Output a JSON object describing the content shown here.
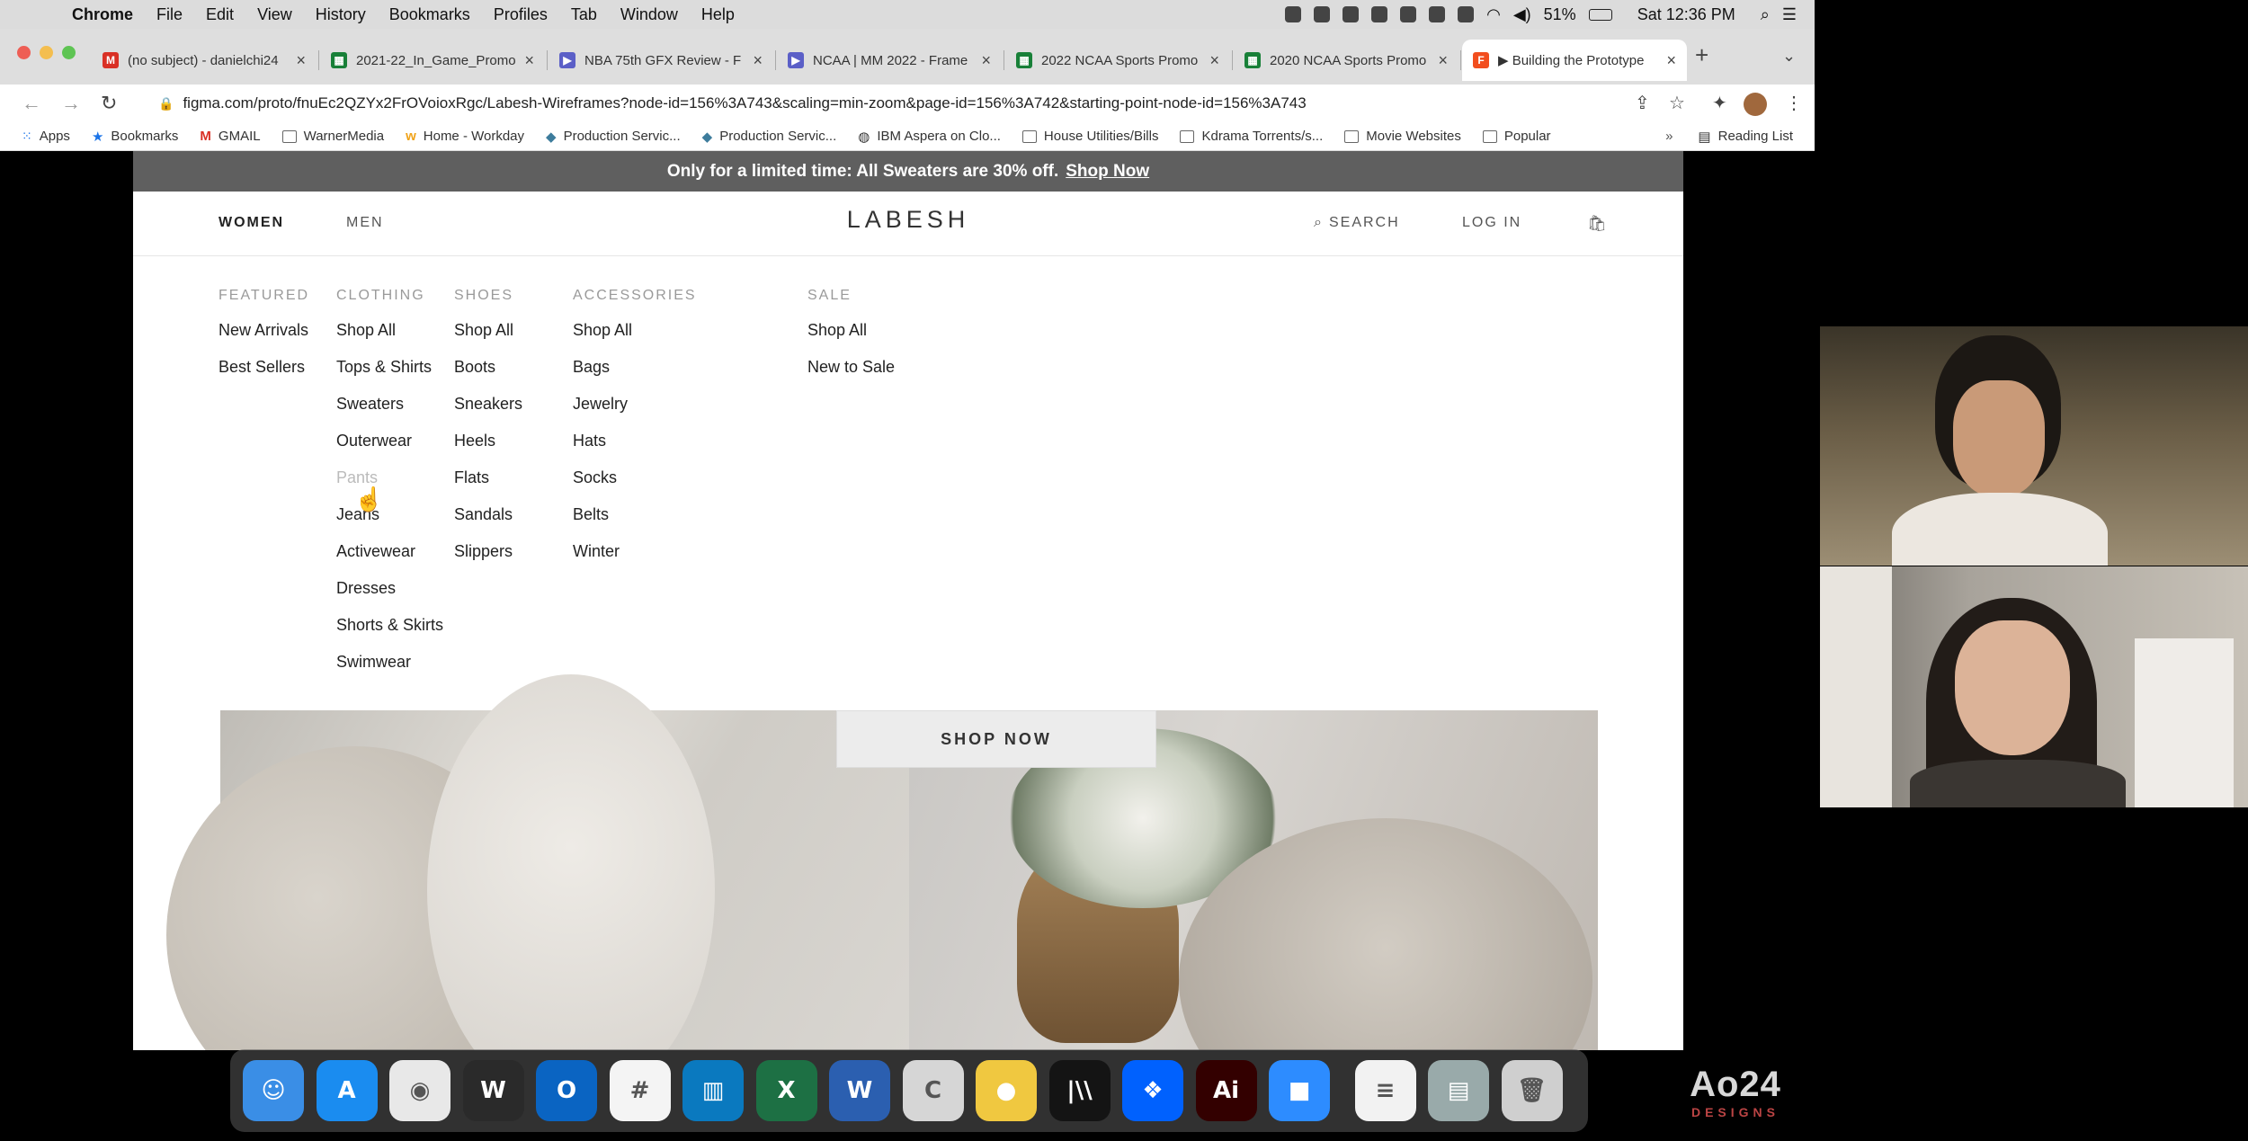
{
  "menubar": {
    "app": "Chrome",
    "items": [
      "File",
      "Edit",
      "View",
      "History",
      "Bookmarks",
      "Profiles",
      "Tab",
      "Window",
      "Help"
    ],
    "battery": "51%",
    "clock": "Sat 12:36 PM"
  },
  "tabs": [
    {
      "label": "(no subject) - danielchi24",
      "icon": "gmail-icon",
      "color": "#d93025"
    },
    {
      "label": "2021-22_In_Game_Promo",
      "icon": "sheets-icon",
      "color": "#188038"
    },
    {
      "label": "NBA 75th GFX Review - F",
      "icon": "frameio-icon",
      "color": "#5b5fc7"
    },
    {
      "label": "NCAA | MM 2022 - Frame",
      "icon": "frameio-icon",
      "color": "#5b5fc7"
    },
    {
      "label": "2022 NCAA Sports Promo",
      "icon": "sheets-icon",
      "color": "#188038"
    },
    {
      "label": "2020 NCAA Sports Promo",
      "icon": "sheets-icon",
      "color": "#188038"
    },
    {
      "label": "▶ Building the Prototype",
      "icon": "figma-icon",
      "color": "#f24e1e"
    }
  ],
  "address": {
    "url": "figma.com/proto/fnuEc2QZYx2FrOVoioxRgc/Labesh-Wireframes?node-id=156%3A743&scaling=min-zoom&page-id=156%3A742&starting-point-node-id=156%3A743"
  },
  "bookmarks": [
    "Apps",
    "Bookmarks",
    "GMAIL",
    "WarnerMedia",
    "Home - Workday",
    "Production Servic...",
    "Production Servic...",
    "IBM Aspera on Clo...",
    "House Utilities/Bills",
    "Kdrama Torrents/s...",
    "Movie Websites",
    "Popular"
  ],
  "reading_list": "Reading List",
  "site": {
    "promo_text": "Only for a limited time: All Sweaters are 30% off.",
    "promo_link": "Shop Now",
    "nav_women": "WOMEN",
    "nav_men": "MEN",
    "brand": "LABESH",
    "search": "SEARCH",
    "login": "LOG IN",
    "shop_now": "SHOP NOW"
  },
  "mega_menu": {
    "featured": {
      "heading": "FEATURED",
      "items": [
        "New Arrivals",
        "Best Sellers"
      ]
    },
    "clothing": {
      "heading": "CLOTHING",
      "items": [
        "Shop All",
        "Tops & Shirts",
        "Sweaters",
        "Outerwear",
        "Pants",
        "Jeans",
        "Activewear",
        "Dresses",
        "Shorts & Skirts",
        "Swimwear"
      ]
    },
    "shoes": {
      "heading": "SHOES",
      "items": [
        "Shop All",
        "Boots",
        "Sneakers",
        "Heels",
        "Flats",
        "Sandals",
        "Slippers"
      ]
    },
    "accessories": {
      "heading": "ACCESSORIES",
      "items": [
        "Shop All",
        "Bags",
        "Jewelry",
        "Hats",
        "Socks",
        "Belts",
        "Winter"
      ]
    },
    "sale": {
      "heading": "SALE",
      "items": [
        "Shop All",
        "New to Sale"
      ]
    }
  },
  "dock": [
    {
      "name": "finder-icon",
      "color": "#3a8ee6",
      "glyph": "☺"
    },
    {
      "name": "app-store-icon",
      "color": "#1a8cf0",
      "glyph": "A"
    },
    {
      "name": "chrome-icon",
      "color": "#e8e8e8",
      "glyph": "◉"
    },
    {
      "name": "webex-icon",
      "color": "#2a2a2a",
      "glyph": "W"
    },
    {
      "name": "outlook-icon",
      "color": "#0a64c2",
      "glyph": "O"
    },
    {
      "name": "slack-icon",
      "color": "#f4f4f4",
      "glyph": "#"
    },
    {
      "name": "trello-icon",
      "color": "#0a79bf",
      "glyph": "▥"
    },
    {
      "name": "excel-icon",
      "color": "#1d7044",
      "glyph": "X"
    },
    {
      "name": "word-icon",
      "color": "#2b5fb0",
      "glyph": "W"
    },
    {
      "name": "sync-icon",
      "color": "#d6d6d6",
      "glyph": "C"
    },
    {
      "name": "cyberduck-icon",
      "color": "#f0c840",
      "glyph": "●"
    },
    {
      "name": "film-app-icon",
      "color": "#141414",
      "glyph": "|\\\\"
    },
    {
      "name": "dropbox-icon",
      "color": "#0061fe",
      "glyph": "❖"
    },
    {
      "name": "illustrator-icon",
      "color": "#330000",
      "glyph": "Ai"
    },
    {
      "name": "zoom-icon",
      "color": "#2d8cff",
      "glyph": "■"
    },
    {
      "name": "document-icon",
      "color": "#f2f2f2",
      "glyph": "≡"
    },
    {
      "name": "downloads-icon",
      "color": "#9aa",
      "glyph": "▤"
    },
    {
      "name": "trash-icon",
      "color": "#cfcfcf",
      "glyph": "🗑"
    }
  ],
  "watermark": {
    "big": "Ao24",
    "small": "DESIGNS"
  }
}
